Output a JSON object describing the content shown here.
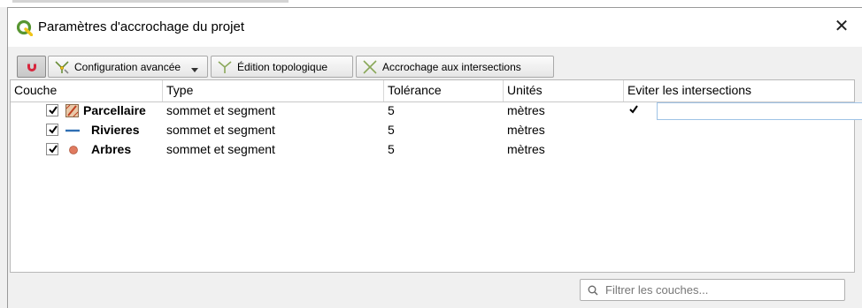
{
  "window": {
    "title": "Paramètres d'accrochage du projet",
    "close_glyph": "✕"
  },
  "toolbar": {
    "config_label": "Configuration avancée",
    "topo_label": "Édition topologique",
    "inter_label": "Accrochage aux intersections"
  },
  "table": {
    "columns": [
      "Couche",
      "Type",
      "Tolérance",
      "Unités",
      "Eviter les intersections"
    ],
    "rows": [
      {
        "checked": true,
        "icon": "polygon-layer-icon",
        "name": "Parcellaire",
        "type": "sommet et segment",
        "tolerance": "5",
        "units": "mètres",
        "avoid": true
      },
      {
        "checked": true,
        "icon": "line-layer-icon",
        "name": "Rivieres",
        "type": "sommet et segment",
        "tolerance": "5",
        "units": "mètres"
      },
      {
        "checked": true,
        "icon": "point-layer-icon",
        "name": "Arbres",
        "type": "sommet et segment",
        "tolerance": "5",
        "units": "mètres"
      }
    ]
  },
  "filter": {
    "placeholder": "Filtrer les couches..."
  },
  "colors": {
    "qgis_green": "#589632",
    "magnet_red": "#d7263d",
    "river_blue": "#2f6fb3",
    "tree_orange": "#e07a5f"
  }
}
